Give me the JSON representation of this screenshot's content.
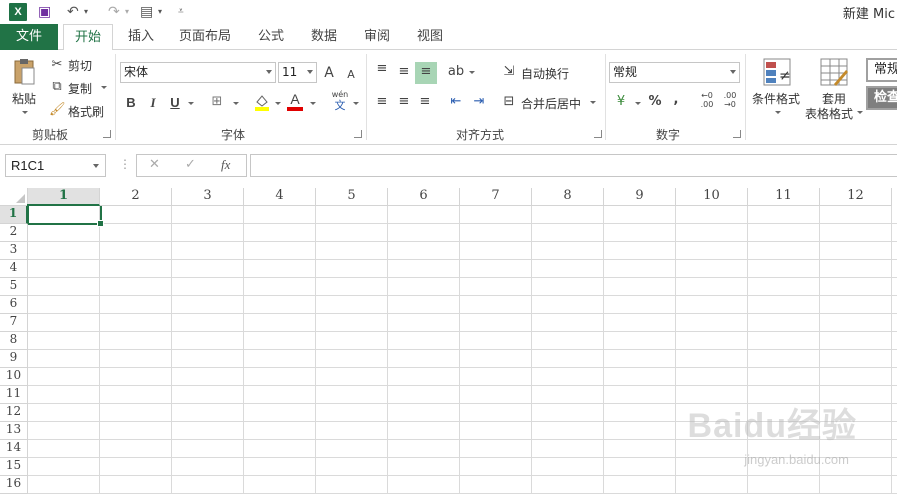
{
  "window": {
    "title": "新建 Mic"
  },
  "tabs": {
    "file": "文件",
    "home": "开始",
    "insert": "插入",
    "layout": "页面布局",
    "formulas": "公式",
    "data": "数据",
    "review": "审阅",
    "view": "视图"
  },
  "clipboard": {
    "paste": "粘贴",
    "cut": "剪切",
    "copy": "复制",
    "painter": "格式刷",
    "label": "剪贴板"
  },
  "font": {
    "name": "宋体",
    "size": "11",
    "grow": "A",
    "shrink": "A",
    "bold": "B",
    "italic": "I",
    "underline": "U",
    "font_color": "A",
    "phonetic_top": "wén",
    "phonetic_bottom": "文",
    "label": "字体"
  },
  "alignment": {
    "wrap": "自动换行",
    "merge": "合并后居中",
    "label": "对齐方式"
  },
  "number": {
    "format": "常规",
    "currency": "¥",
    "percent": "%",
    "comma": ",",
    "inc_top": "←0",
    "inc_bottom": ".00",
    "dec_top": ".00",
    "dec_bottom": "→0",
    "label": "数字"
  },
  "styles": {
    "conditional": "条件格式",
    "table_top": "套用",
    "table_bottom": "表格格式",
    "normal": "常规",
    "check": "检查"
  },
  "formula_bar": {
    "name_box": "R1C1",
    "cancel": "✕",
    "enter": "✓",
    "fx": "fx",
    "content": ""
  },
  "columns": [
    "1",
    "2",
    "3",
    "4",
    "5",
    "6",
    "7",
    "8",
    "9",
    "10",
    "11",
    "12"
  ],
  "rows": [
    "1",
    "2",
    "3",
    "4",
    "5",
    "6",
    "7",
    "8",
    "9",
    "10",
    "11",
    "12",
    "13",
    "14",
    "15",
    "16"
  ],
  "watermark": {
    "main": "Baidu经验",
    "sub": "jingyan.baidu.com"
  }
}
